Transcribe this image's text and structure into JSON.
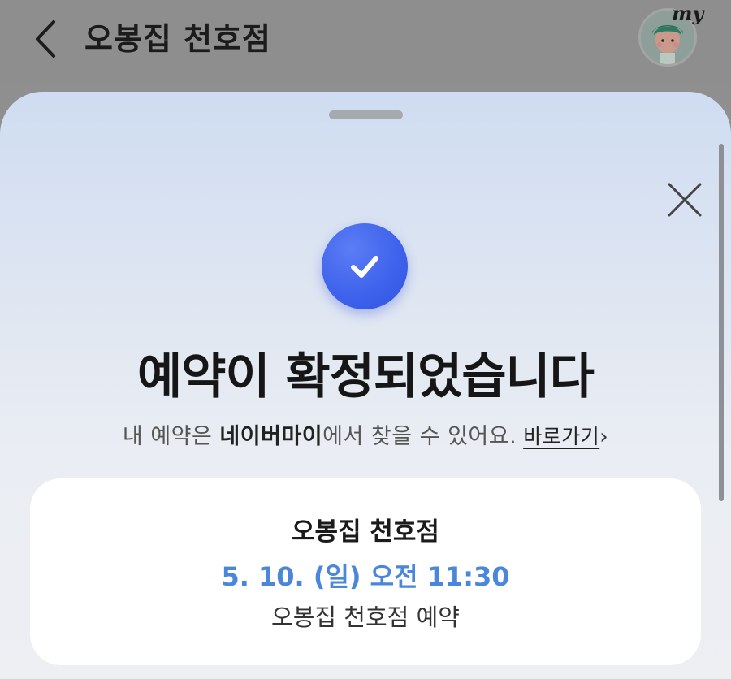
{
  "header": {
    "title": "오봉집 천호점",
    "avatar_badge": "my"
  },
  "sheet": {
    "heading": "예약이 확정되었습니다",
    "subtext_before": "내 예약은 ",
    "subtext_bold": "네이버마이",
    "subtext_after": "에서 찾을 수 있어요.",
    "link_label": "바로가기",
    "link_chevron": "›"
  },
  "reservation": {
    "store_name": "오봉집 천호점",
    "datetime": "5. 10. (일) 오전 11:30",
    "type": "오봉집 천호점 예약"
  },
  "colors": {
    "accent_blue": "#3f63ec",
    "datetime_blue": "#4a86d9"
  },
  "icons": {
    "back": "chevron-left-icon",
    "close": "close-icon",
    "check": "check-icon"
  }
}
